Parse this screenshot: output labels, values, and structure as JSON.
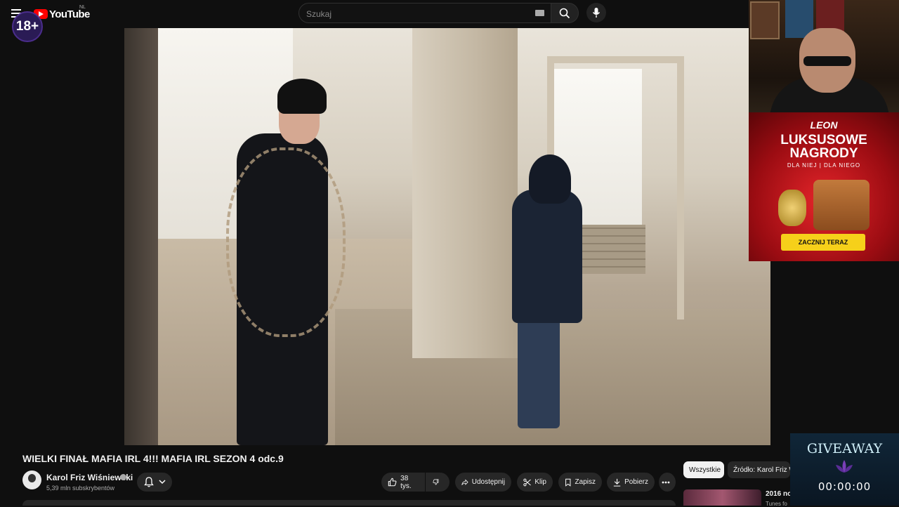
{
  "header": {
    "logo_text": "YouTube",
    "country_code": "NL",
    "age_badge": "18+",
    "search_placeholder": "Szukaj"
  },
  "video": {
    "title": "WIELKI FINAŁ MAFIA IRL 4!!! MAFIA IRL SEZON 4 odc.9",
    "channel_name": "Karol Friz Wiśniewski",
    "subscribers": "5,39 mln subskrybentów",
    "likes": "38 tys."
  },
  "actions": {
    "share": "Udostępnij",
    "clip": "Klip",
    "save": "Zapisz",
    "download": "Pobierz"
  },
  "sidebar": {
    "chip_all": "Wszystkie",
    "chip_source": "Źródło: Karol Friz Wiśniewski",
    "rec_title": "2016 no",
    "rec_sub": "Tunes fo"
  },
  "ad": {
    "brand": "LEON",
    "headline": "LUKSUSOWE NAGRODY",
    "subline": "DLA NIEJ | DLA NIEGO",
    "cta": "ZACZNIJ TERAZ"
  },
  "giveaway": {
    "title": "GIVEAWAY",
    "timer": "00:00:00"
  },
  "colors": {
    "background": "#0f0f0f",
    "brand_red": "#ff0000",
    "ad_red": "#e5252a",
    "ad_cta": "#f6d01a"
  }
}
